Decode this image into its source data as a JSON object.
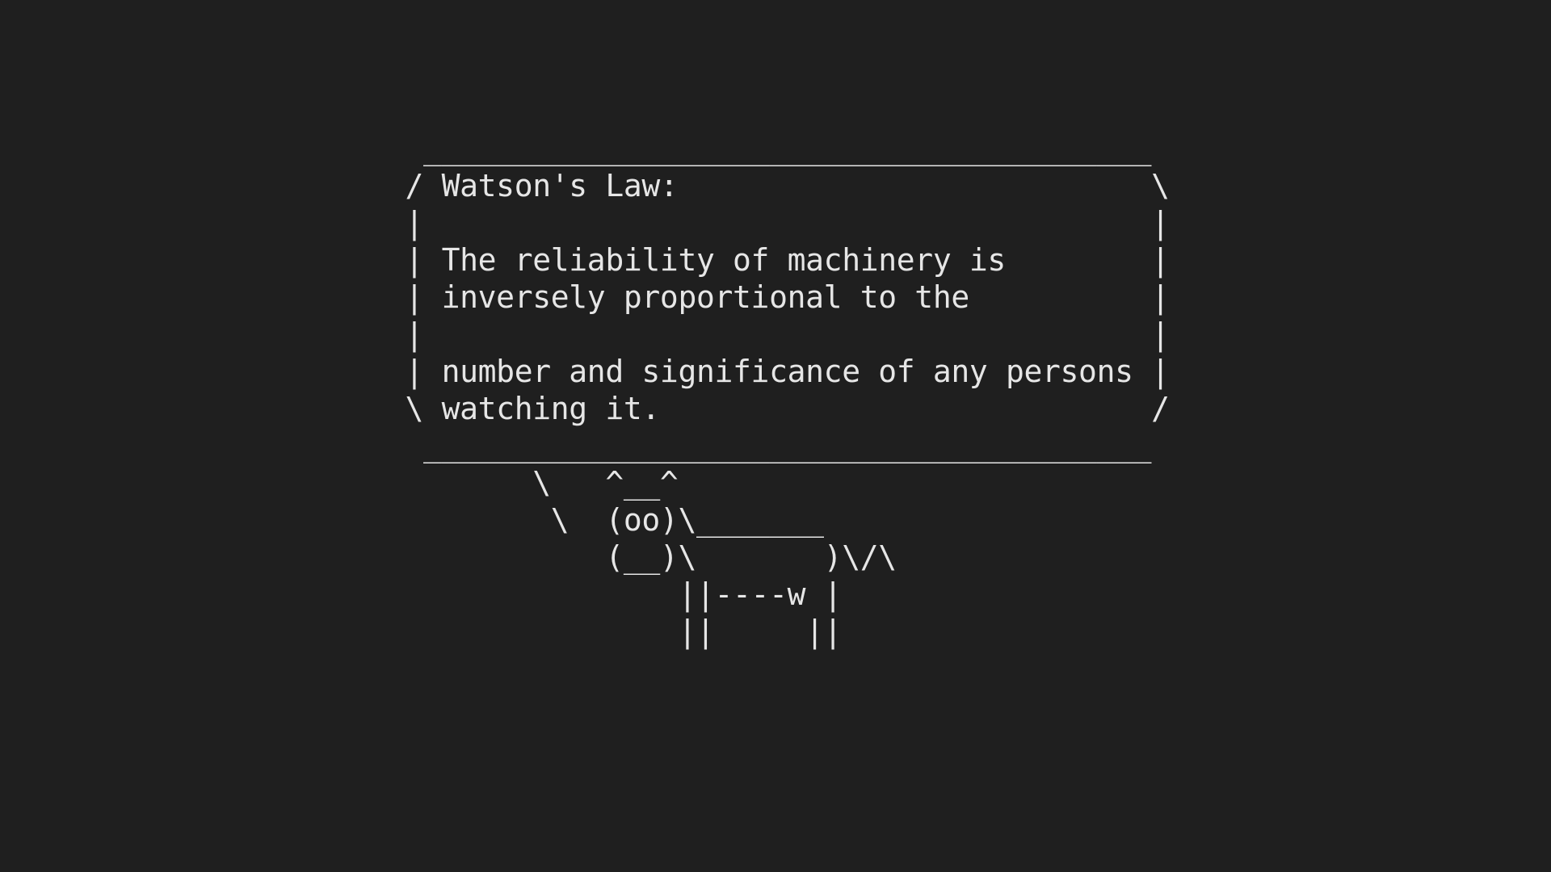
{
  "terminal": {
    "background": "#1f1f1f",
    "foreground": "#e6e6e6",
    "lines": [
      "  ________________________________________",
      " / Watson's Law:                          \\",
      " |                                        |",
      " | The reliability of machinery is        |",
      " | inversely proportional to the          |",
      " |                                        |",
      " | number and significance of any persons |",
      " \\ watching it.                           /",
      "  ________________________________________",
      "        \\   ^__^",
      "         \\  (oo)\\_______",
      "            (__)\\       )\\/\\",
      "                ||----w |",
      "                ||     ||"
    ]
  }
}
